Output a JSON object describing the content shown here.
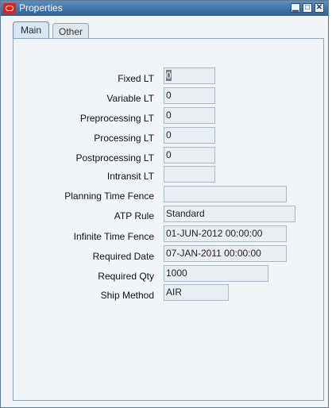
{
  "window": {
    "title": "Properties",
    "buttons": {
      "minimize": "▁",
      "maximize": "□",
      "close": "✕"
    }
  },
  "tabs": [
    {
      "label": "Main",
      "active": true
    },
    {
      "label": "Other",
      "active": false
    }
  ],
  "fields": {
    "fixed_lt": {
      "label": "Fixed LT",
      "value": "0"
    },
    "variable_lt": {
      "label": "Variable LT",
      "value": "0"
    },
    "preprocessing_lt": {
      "label": "Preprocessing LT",
      "value": "0"
    },
    "processing_lt": {
      "label": "Processing LT",
      "value": "0"
    },
    "postprocessing_lt": {
      "label": "Postprocessing LT",
      "value": "0"
    },
    "intransit_lt": {
      "label": "Intransit LT",
      "value": ""
    },
    "planning_time_fence": {
      "label": "Planning Time Fence",
      "value": ""
    },
    "atp_rule": {
      "label": "ATP Rule",
      "value": "Standard"
    },
    "infinite_time_fence": {
      "label": "Infinite Time Fence",
      "value": "01-JUN-2012 00:00:00"
    },
    "required_date": {
      "label": "Required Date",
      "value": "07-JAN-2011 00:00:00"
    },
    "required_qty": {
      "label": "Required Qty",
      "value": "1000"
    },
    "ship_method": {
      "label": "Ship Method",
      "value": "AIR"
    }
  }
}
